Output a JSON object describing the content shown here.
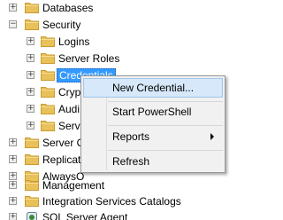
{
  "tree": {
    "items": [
      {
        "label": "Databases",
        "toggle": "+"
      },
      {
        "label": "Security",
        "toggle": "−"
      },
      {
        "label": "Logins",
        "toggle": "+"
      },
      {
        "label": "Server Roles",
        "toggle": "+"
      },
      {
        "label": "Credentials",
        "toggle": "+"
      },
      {
        "label": "Cryp",
        "toggle": "+"
      },
      {
        "label": "Audi",
        "toggle": "+"
      },
      {
        "label": "Serv",
        "toggle": "+"
      },
      {
        "label": "Server O",
        "toggle": "+"
      },
      {
        "label": "Replicat",
        "toggle": "+"
      },
      {
        "label": "AlwaysO",
        "toggle": "+"
      },
      {
        "label": "Management",
        "toggle": "+"
      },
      {
        "label": "Integration Services Catalogs",
        "toggle": "+"
      },
      {
        "label": "SQL Server Agent",
        "toggle": "+"
      }
    ],
    "selected": "Credentials"
  },
  "context_menu": {
    "items": [
      {
        "label": "New Credential..."
      },
      {
        "label": "Start PowerShell"
      },
      {
        "label": "Reports"
      },
      {
        "label": "Refresh"
      }
    ]
  },
  "colors": {
    "folder": "#e8c15a",
    "folder_dark": "#c99a2e",
    "selection": "#3399ff",
    "menu_highlight": "#d6e8f9"
  }
}
